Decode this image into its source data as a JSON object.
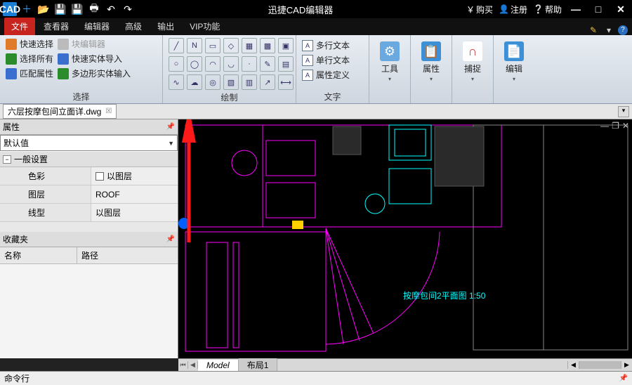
{
  "titlebar": {
    "app_title": "迅捷CAD编辑器",
    "buy": "购买",
    "register": "注册",
    "help": "帮助"
  },
  "tabs": {
    "items": [
      "文件",
      "查看器",
      "编辑器",
      "高级",
      "输出",
      "VIP功能"
    ],
    "active_index": 0
  },
  "ribbon": {
    "select": {
      "label": "选择",
      "col1": [
        "快速选择",
        "选择所有",
        "匹配属性"
      ],
      "col2": [
        "块编辑器",
        "快速实体导入",
        "多边形实体输入"
      ]
    },
    "draw": {
      "label": "绘制"
    },
    "text": {
      "label": "文字",
      "rows": [
        "多行文本",
        "单行文本",
        "属性定义"
      ]
    },
    "tools": {
      "label": "工具"
    },
    "attribute": {
      "label": "属性"
    },
    "snap": {
      "label": "捕捉"
    },
    "edit": {
      "label": "编辑"
    }
  },
  "doc": {
    "filename": "六层按摩包间立面详.dwg"
  },
  "properties": {
    "panel_title": "属性",
    "default_value": "默认值",
    "section": "一般设置",
    "rows": [
      {
        "k": "色彩",
        "v": "以图层",
        "swatch": true
      },
      {
        "k": "图层",
        "v": "ROOF"
      },
      {
        "k": "线型",
        "v": "以图层"
      }
    ],
    "favorites_title": "收藏夹",
    "fav_cols": [
      "名称",
      "路径"
    ]
  },
  "layout": {
    "tabs": [
      "Model",
      "布局1"
    ]
  },
  "cmd": {
    "label": "命令行"
  },
  "canvas": {
    "annotation": "按摩包间2平面图 1:50"
  }
}
